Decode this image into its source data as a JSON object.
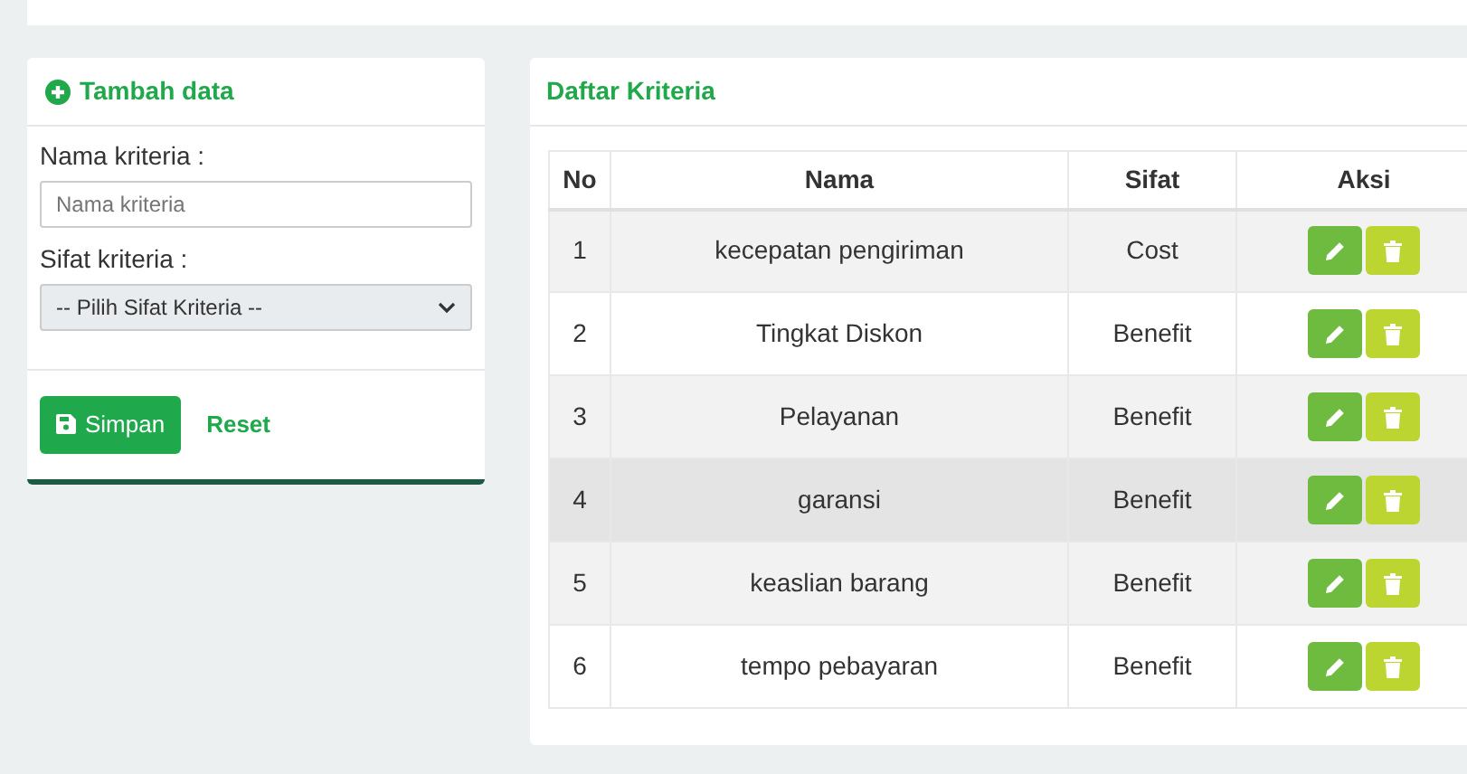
{
  "add_card": {
    "title": "Tambah data",
    "fields": [
      {
        "kind": "input",
        "label": "Nama kriteria :",
        "placeholder": "Nama kriteria"
      },
      {
        "kind": "select",
        "label": "Sifat kriteria :",
        "value": "-- Pilih Sifat Kriteria --"
      }
    ],
    "buttons": [
      {
        "kind": "primary",
        "label": "Simpan"
      },
      {
        "kind": "link",
        "label": "Reset"
      }
    ]
  },
  "list_card": {
    "title": "Daftar Kriteria",
    "columns": [
      "No",
      "Nama",
      "Sifat",
      "Aksi"
    ],
    "rows": [
      {
        "no": "1",
        "nama": "kecepatan pengiriman",
        "sifat": "Cost",
        "highlighted": false
      },
      {
        "no": "2",
        "nama": "Tingkat Diskon",
        "sifat": "Benefit",
        "highlighted": false
      },
      {
        "no": "3",
        "nama": "Pelayanan",
        "sifat": "Benefit",
        "highlighted": false
      },
      {
        "no": "4",
        "nama": "garansi",
        "sifat": "Benefit",
        "highlighted": true
      },
      {
        "no": "5",
        "nama": "keaslian barang",
        "sifat": "Benefit",
        "highlighted": false
      },
      {
        "no": "6",
        "nama": "tempo pebayaran",
        "sifat": "Benefit",
        "highlighted": false
      }
    ]
  }
}
